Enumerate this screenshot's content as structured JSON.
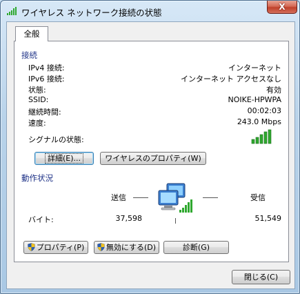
{
  "window": {
    "title": "ワイヤレス ネットワーク接続の状態",
    "close_label": "X"
  },
  "tabs": [
    {
      "label": "全般",
      "selected": true
    }
  ],
  "connection": {
    "title": "接続",
    "rows": [
      {
        "label": "IPv4 接続:",
        "value": "インターネット"
      },
      {
        "label": "IPv6 接続:",
        "value": "インターネット アクセスなし"
      },
      {
        "label": "状態:",
        "value": "有効"
      },
      {
        "label": "SSID:",
        "value": "NOIKE-HPWPA"
      },
      {
        "label": "継続時間:",
        "value": "00:02:03"
      },
      {
        "label": "速度:",
        "value": "243.0 Mbps"
      }
    ],
    "signal_label": "シグナルの状態:",
    "signal_bars": 5,
    "details_button": "詳細(E)...",
    "wireless_props_button": "ワイヤレスのプロパティ(W)"
  },
  "activity": {
    "title": "動作状況",
    "sent_label": "送信",
    "received_label": "受信",
    "bytes_label": "バイト:",
    "bytes_sent": "37,598",
    "bytes_received": "51,549"
  },
  "actions": {
    "properties_button": "プロパティ(P)",
    "disable_button": "無効にする(D)",
    "diagnose_button": "診断(G)"
  },
  "footer": {
    "close_button": "閉じる(C)"
  },
  "colors": {
    "signal_green": "#2fa82f",
    "group_title": "#1e3287",
    "shield_blue": "#2c5fb3",
    "shield_yellow": "#f2c21b"
  }
}
